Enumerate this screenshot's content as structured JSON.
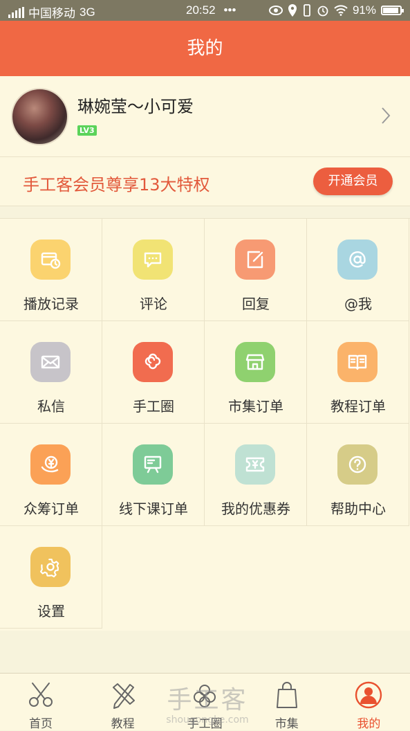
{
  "status_bar": {
    "carrier": "中国移动",
    "network": "3G",
    "time": "20:52",
    "more": "•••",
    "battery": "91%",
    "battery_level": 0.91
  },
  "header": {
    "title": "我的"
  },
  "profile": {
    "username": "琳婉莹～小可爱",
    "level": "LV3"
  },
  "membership": {
    "text": "手工客会员尊享13大特权",
    "button": "开通会员"
  },
  "menu": [
    {
      "label": "播放记录",
      "icon": "play-history-icon",
      "color": "#fbd36f"
    },
    {
      "label": "评论",
      "icon": "comment-icon",
      "color": "#f1e374"
    },
    {
      "label": "回复",
      "icon": "reply-edit-icon",
      "color": "#f79a73"
    },
    {
      "label": "@我",
      "icon": "at-icon",
      "color": "#a9d6e1"
    },
    {
      "label": "私信",
      "icon": "mail-icon",
      "color": "#c7c4c9"
    },
    {
      "label": "手工圈",
      "icon": "flower-icon",
      "color": "#f16c4f"
    },
    {
      "label": "市集订单",
      "icon": "shop-icon",
      "color": "#8fd16f"
    },
    {
      "label": "教程订单",
      "icon": "book-icon",
      "color": "#fbb36a"
    },
    {
      "label": "众筹订单",
      "icon": "crowdfund-icon",
      "color": "#fba156"
    },
    {
      "label": "线下课订单",
      "icon": "classroom-icon",
      "color": "#7ecb97"
    },
    {
      "label": "我的优惠券",
      "icon": "coupon-icon",
      "color": "#bfe1d3"
    },
    {
      "label": "帮助中心",
      "icon": "help-icon",
      "color": "#d6cc88"
    },
    {
      "label": "设置",
      "icon": "settings-icon",
      "color": "#f0c25d"
    }
  ],
  "tabs": [
    {
      "label": "首页",
      "icon": "scissors-icon",
      "active": false
    },
    {
      "label": "教程",
      "icon": "pencil-ruler-icon",
      "active": false
    },
    {
      "label": "手工圈",
      "icon": "flower-outline-icon",
      "active": false
    },
    {
      "label": "市集",
      "icon": "shopping-bag-icon",
      "active": false
    },
    {
      "label": "我的",
      "icon": "user-icon",
      "active": true
    }
  ],
  "watermark": {
    "main": "手工客",
    "url": "shougongke.com"
  },
  "colors": {
    "header": "#f06844",
    "accent": "#ec5e3f",
    "background": "#fdf8e0"
  }
}
